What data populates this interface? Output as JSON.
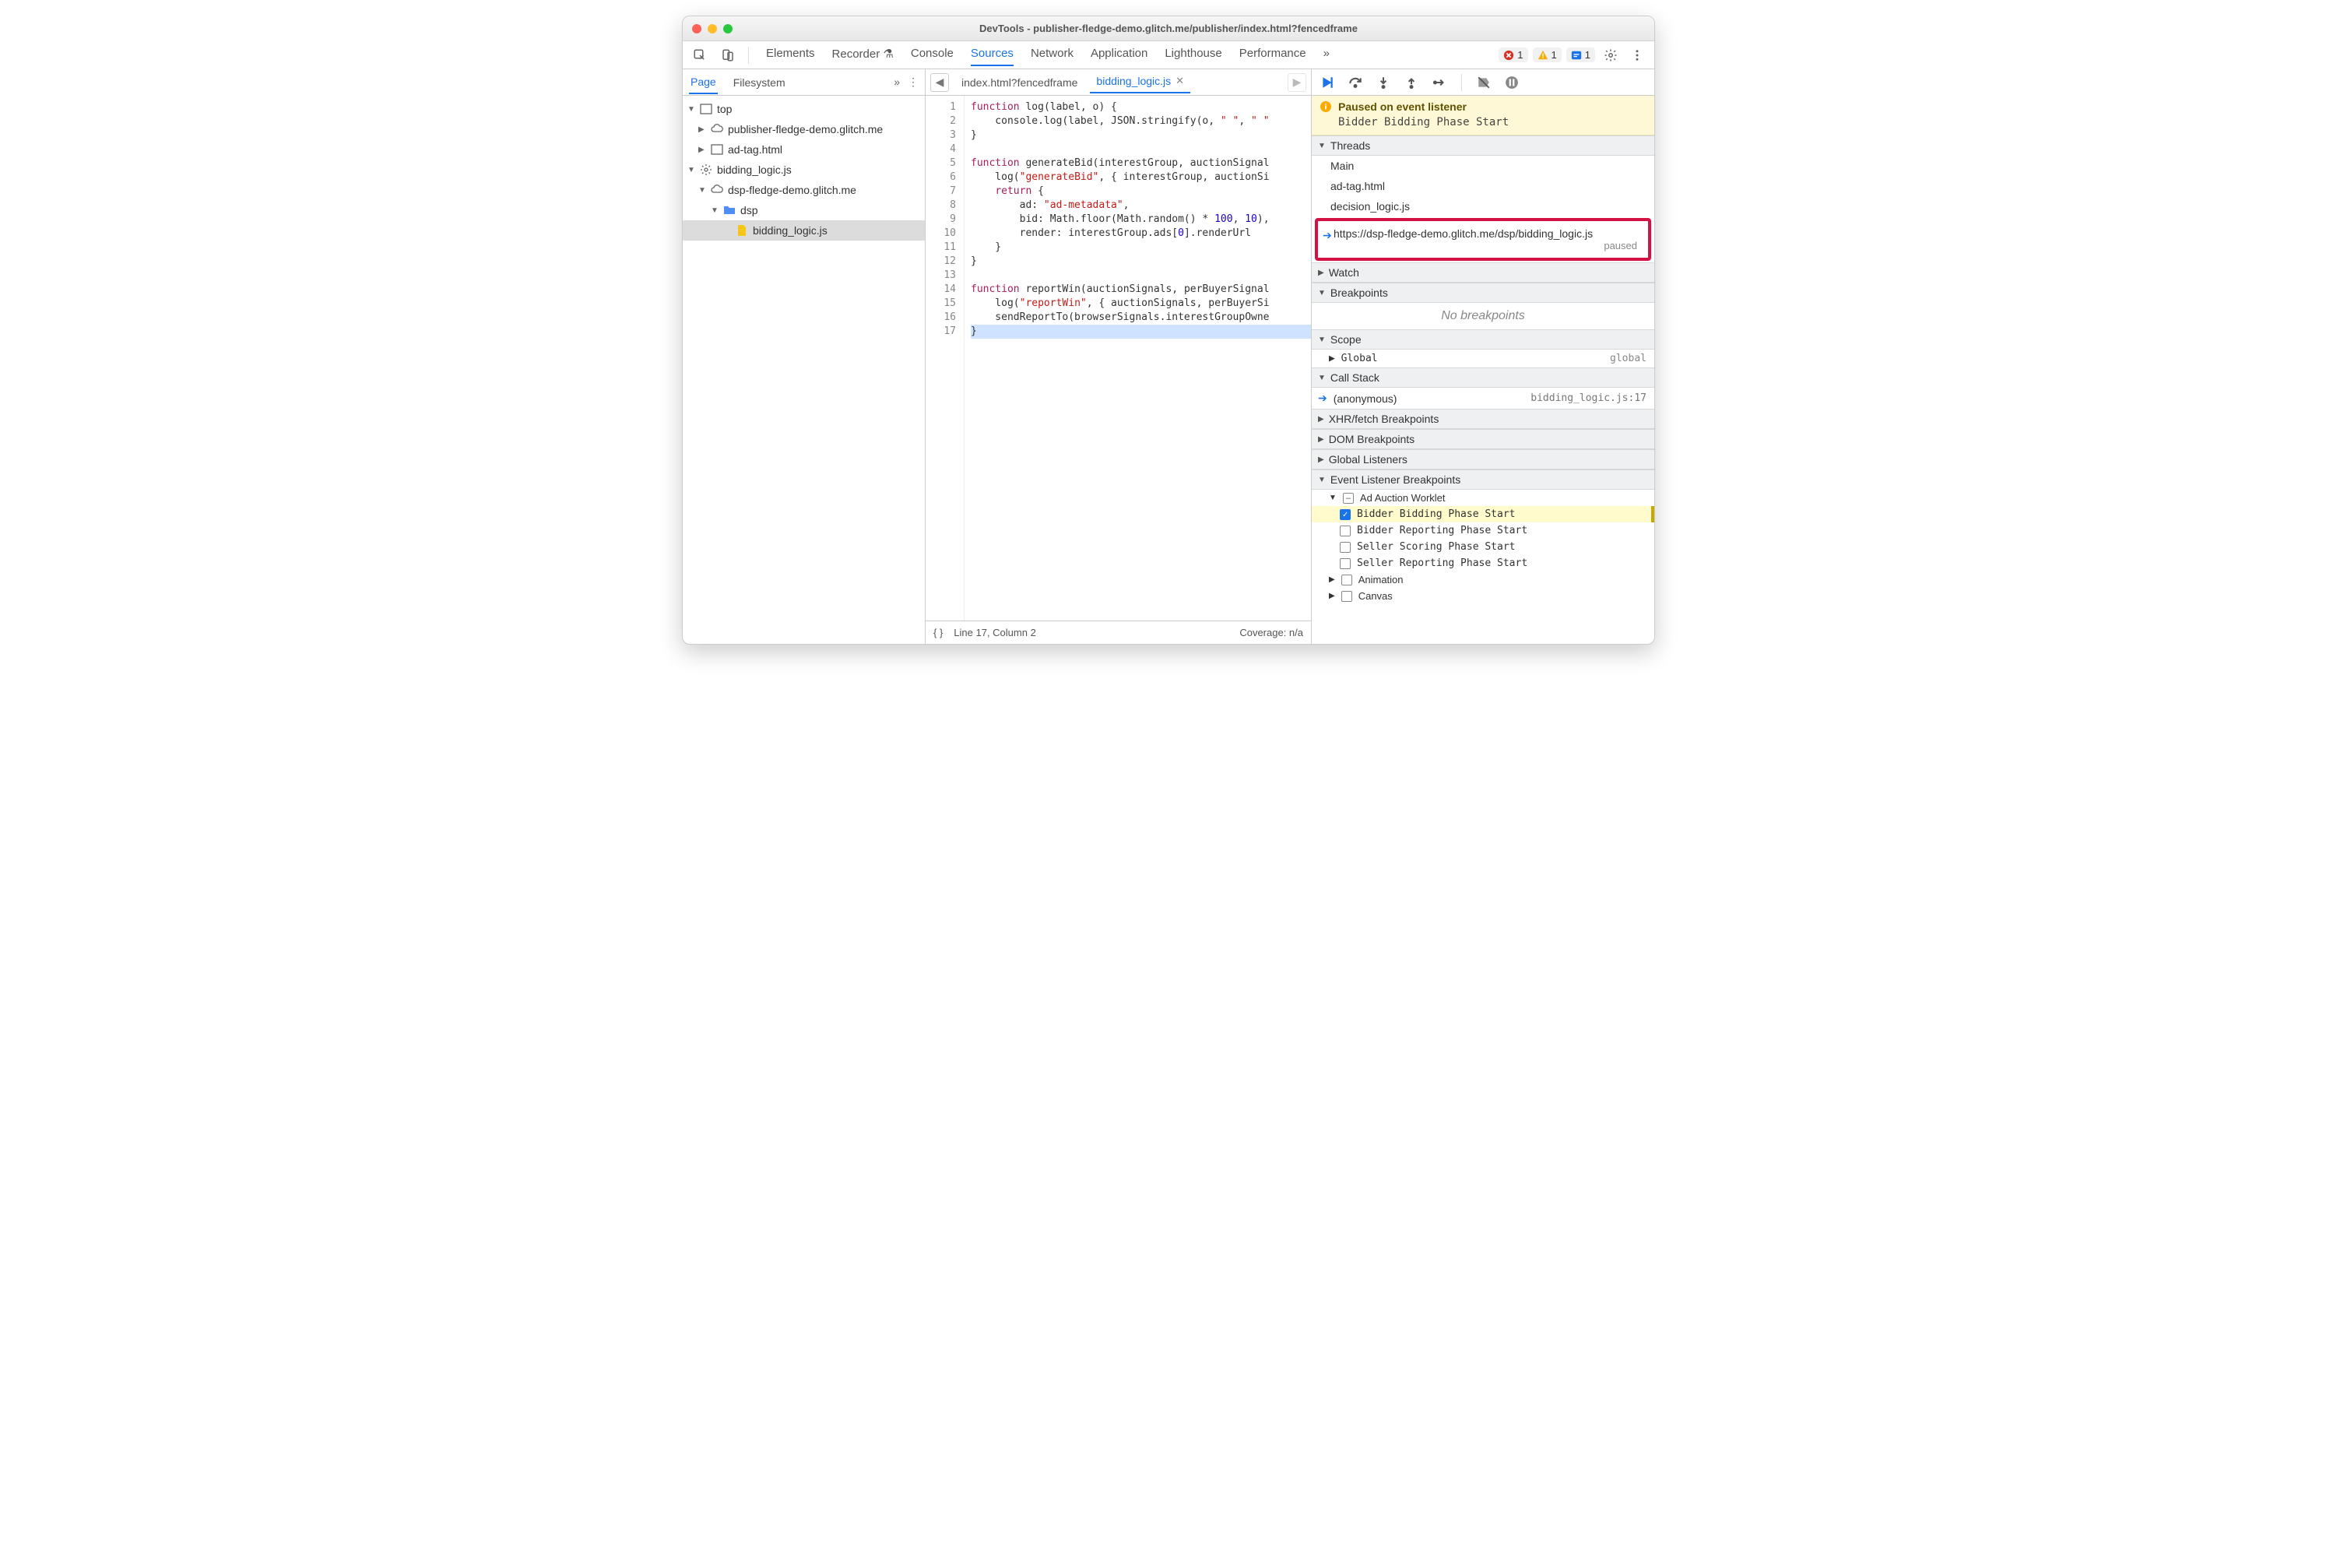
{
  "window": {
    "title": "DevTools - publisher-fledge-demo.glitch.me/publisher/index.html?fencedframe"
  },
  "main_tabs": [
    "Elements",
    "Recorder",
    "Console",
    "Sources",
    "Network",
    "Application",
    "Lighthouse",
    "Performance"
  ],
  "main_tab_active": "Sources",
  "counters": {
    "errors": "1",
    "warnings": "1",
    "issues": "1"
  },
  "left": {
    "tabs": [
      "Page",
      "Filesystem"
    ],
    "active": "Page",
    "tree": {
      "top": "top",
      "origin1": "publisher-fledge-demo.glitch.me",
      "adtag": "ad-tag.html",
      "worklet": "bidding_logic.js",
      "origin2": "dsp-fledge-demo.glitch.me",
      "folder": "dsp",
      "file": "bidding_logic.js"
    }
  },
  "center": {
    "tabs": [
      {
        "label": "index.html?fencedframe",
        "active": false,
        "close": false
      },
      {
        "label": "bidding_logic.js",
        "active": true,
        "close": true
      }
    ],
    "gutter": "1\n2\n3\n4\n5\n6\n7\n8\n9\n10\n11\n12\n13\n14\n15\n16\n17",
    "status": {
      "line": "Line 17, Column 2",
      "coverage": "Coverage: n/a"
    }
  },
  "debugger": {
    "paused_title": "Paused on event listener",
    "paused_detail": "Bidder Bidding Phase Start",
    "sections": {
      "threads": "Threads",
      "watch": "Watch",
      "breakpoints": "Breakpoints",
      "scope": "Scope",
      "callstack": "Call Stack",
      "xhr": "XHR/fetch Breakpoints",
      "dom": "DOM Breakpoints",
      "global": "Global Listeners",
      "event": "Event Listener Breakpoints"
    },
    "threads": {
      "items": [
        "Main",
        "ad-tag.html",
        "decision_logic.js"
      ],
      "highlighted": "https://dsp-fledge-demo.glitch.me/dsp/bidding_logic.js",
      "highlighted_status": "paused"
    },
    "no_breakpoints": "No breakpoints",
    "scope": {
      "label": "Global",
      "value": "global"
    },
    "callstack": {
      "name": "(anonymous)",
      "loc": "bidding_logic.js:17"
    },
    "event_bp": {
      "category": "Ad Auction Worklet",
      "items": [
        {
          "label": "Bidder Bidding Phase Start",
          "checked": true
        },
        {
          "label": "Bidder Reporting Phase Start",
          "checked": false
        },
        {
          "label": "Seller Scoring Phase Start",
          "checked": false
        },
        {
          "label": "Seller Reporting Phase Start",
          "checked": false
        }
      ],
      "animation": "Animation",
      "canvas": "Canvas"
    }
  }
}
